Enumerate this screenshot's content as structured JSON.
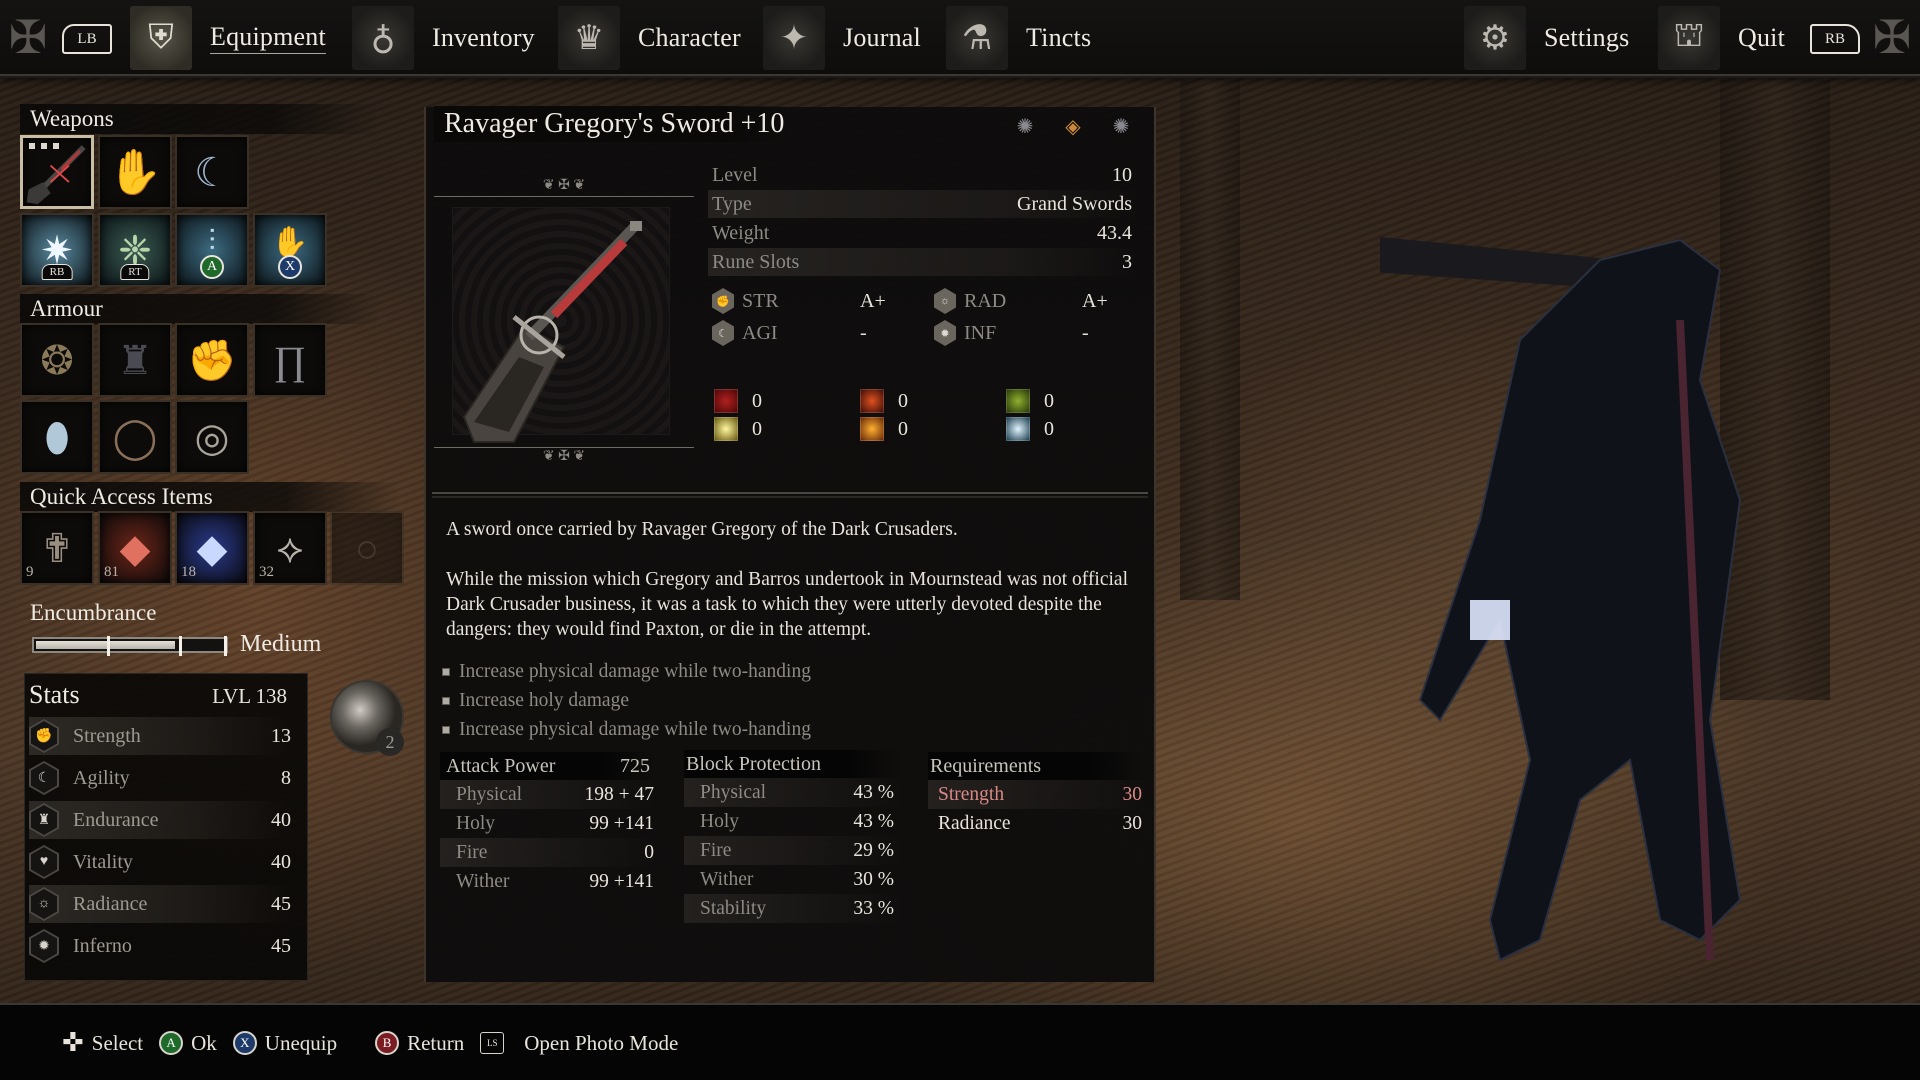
{
  "top_nav": {
    "left_bumper": "LB",
    "right_bumper": "RB",
    "tabs": [
      {
        "label": "Equipment",
        "icon": "shield-icon",
        "active": true
      },
      {
        "label": "Inventory",
        "icon": "pouch-icon",
        "active": false
      },
      {
        "label": "Character",
        "icon": "crown-icon",
        "active": false
      },
      {
        "label": "Journal",
        "icon": "journal-icon",
        "active": false
      },
      {
        "label": "Tincts",
        "icon": "tinct-icon",
        "active": false
      }
    ],
    "right_tabs": [
      {
        "label": "Settings",
        "icon": "gear-icon"
      },
      {
        "label": "Quit",
        "icon": "door-icon"
      }
    ]
  },
  "equipment": {
    "weapons_label": "Weapons",
    "weapons_row1": [
      {
        "item": "Ravager Gregory's Sword",
        "icon": "greatsword-icon",
        "selected": true,
        "rune_slots": 3
      },
      {
        "item": "Empty offhand",
        "icon": "hand-icon"
      },
      {
        "item": "Umbral lantern",
        "icon": "lantern-icon"
      }
    ],
    "weapons_row2": [
      {
        "item": "Spell",
        "icon": "star-burst-icon",
        "button": "RB"
      },
      {
        "item": "Spell",
        "icon": "thorn-icon",
        "button": "RT"
      },
      {
        "item": "Spell",
        "icon": "swords-rain-icon",
        "button": "A"
      },
      {
        "item": "Spell",
        "icon": "spectral-hand-icon",
        "button": "X"
      }
    ],
    "armour_label": "Armour",
    "armour_row1": [
      {
        "item": "Helm",
        "icon": "thorn-crown-icon"
      },
      {
        "item": "Chest",
        "icon": "chest-armour-icon"
      },
      {
        "item": "Gauntlets",
        "icon": "gauntlet-icon"
      },
      {
        "item": "Legs",
        "icon": "leggings-icon"
      }
    ],
    "armour_row2": [
      {
        "item": "Amulet",
        "icon": "amulet-icon"
      },
      {
        "item": "Ring",
        "icon": "ring-icon"
      },
      {
        "item": "Ring",
        "icon": "signet-ring-icon"
      }
    ],
    "quick_access_label": "Quick Access Items",
    "quick_access": [
      {
        "icon": "bone-cross-icon",
        "count": "9"
      },
      {
        "icon": "red-stone-icon",
        "count": "81"
      },
      {
        "icon": "blue-stone-icon",
        "count": "18"
      },
      {
        "icon": "moth-icon",
        "count": "32"
      },
      {
        "icon": "empty-slot-icon",
        "count": ""
      }
    ],
    "encumbrance_label": "Encumbrance",
    "encumbrance_level": "Medium",
    "encumbrance_fill": 0.74
  },
  "stats": {
    "title": "Stats",
    "level": "LVL 138",
    "rows": [
      {
        "name": "Strength",
        "value": "13",
        "icon": "fist-icon"
      },
      {
        "name": "Agility",
        "value": "8",
        "icon": "boot-icon"
      },
      {
        "name": "Endurance",
        "value": "40",
        "icon": "armor-icon"
      },
      {
        "name": "Vitality",
        "value": "40",
        "icon": "heart-icon"
      },
      {
        "name": "Radiance",
        "value": "45",
        "icon": "sun-icon"
      },
      {
        "name": "Inferno",
        "value": "45",
        "icon": "flame-icon"
      }
    ],
    "portrait_count": "2"
  },
  "item": {
    "title": "Ravager Gregory's Sword +10",
    "rune_slot_icons": [
      "rune-slot-empty-icon",
      "rune-slot-filled-icon",
      "rune-slot-empty-icon"
    ],
    "properties": [
      {
        "key": "Level",
        "value": "10"
      },
      {
        "key": "Type",
        "value": "Grand Swords"
      },
      {
        "key": "Weight",
        "value": "43.4"
      },
      {
        "key": "Rune Slots",
        "value": "3"
      }
    ],
    "scaling": [
      {
        "stat": "STR",
        "grade": "A+"
      },
      {
        "stat": "RAD",
        "grade": "A+"
      },
      {
        "stat": "AGI",
        "grade": "-"
      },
      {
        "stat": "INF",
        "grade": "-"
      }
    ],
    "buildups": [
      {
        "type": "bleed",
        "value": "0",
        "color": "#8a1414"
      },
      {
        "type": "burn",
        "value": "0",
        "color": "#a83214"
      },
      {
        "type": "poison",
        "value": "0",
        "color": "#6a8a1e"
      },
      {
        "type": "holy",
        "value": "0",
        "color": "#d8c84a"
      },
      {
        "type": "fire",
        "value": "0",
        "color": "#e07a20"
      },
      {
        "type": "frost",
        "value": "0",
        "color": "#8ab8c8"
      }
    ],
    "description": [
      "A sword once carried by Ravager Gregory of the Dark Crusaders.",
      "While the mission which Gregory and Barros undertook in Mournstead was not official Dark Crusader business, it was a task to which they were utterly devoted despite the dangers: they would find Paxton, or die in the attempt."
    ],
    "perks": [
      "Increase physical damage while two-handing",
      "Increase holy damage",
      "Increase physical damage while two-handing"
    ],
    "attack_power": {
      "label": "Attack Power",
      "total": "725",
      "rows": [
        {
          "key": "Physical",
          "value": "198 + 47"
        },
        {
          "key": "Holy",
          "value": "99 +141"
        },
        {
          "key": "Fire",
          "value": "0"
        },
        {
          "key": "Wither",
          "value": "99 +141"
        }
      ]
    },
    "block_protection": {
      "label": "Block Protection",
      "rows": [
        {
          "key": "Physical",
          "value": "43 %"
        },
        {
          "key": "Holy",
          "value": "43 %"
        },
        {
          "key": "Fire",
          "value": "29 %"
        },
        {
          "key": "Wither",
          "value": "30 %"
        },
        {
          "key": "Stability",
          "value": "33 %"
        }
      ]
    },
    "requirements": {
      "label": "Requirements",
      "rows": [
        {
          "key": "Strength",
          "value": "30",
          "unmet": true
        },
        {
          "key": "Radiance",
          "value": "30",
          "unmet": false
        }
      ]
    }
  },
  "bottom_hints": [
    {
      "icon": "dpad-icon",
      "label": "Select"
    },
    {
      "icon": "a-button-icon",
      "button": "A",
      "label": "Ok"
    },
    {
      "icon": "x-button-icon",
      "button": "X",
      "label": "Unequip"
    },
    {
      "icon": "b-button-icon",
      "button": "B",
      "label": "Return"
    },
    {
      "icon": "ls-button-icon",
      "button": "LS",
      "label": "Open Photo Mode"
    }
  ]
}
